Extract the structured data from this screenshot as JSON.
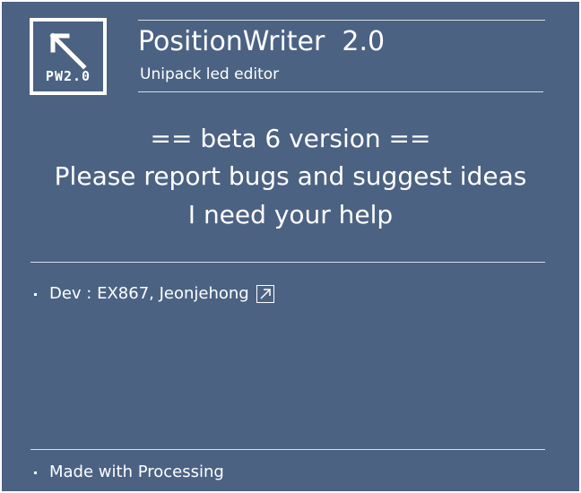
{
  "header": {
    "logo_text": "PW2.0",
    "title": "PositionWriter  2.0",
    "subtitle": "Unipack led editor"
  },
  "notice": {
    "line1": "== beta 6 version ==",
    "line2": "Please report bugs and suggest ideas",
    "line3": "I need your help"
  },
  "dev": {
    "label": "Dev : EX867, Jeonjehong",
    "link_icon": "external-link-icon"
  },
  "footer": {
    "label": "Made with Processing"
  },
  "colors": {
    "background": "#4b6283",
    "foreground": "#ffffff"
  }
}
